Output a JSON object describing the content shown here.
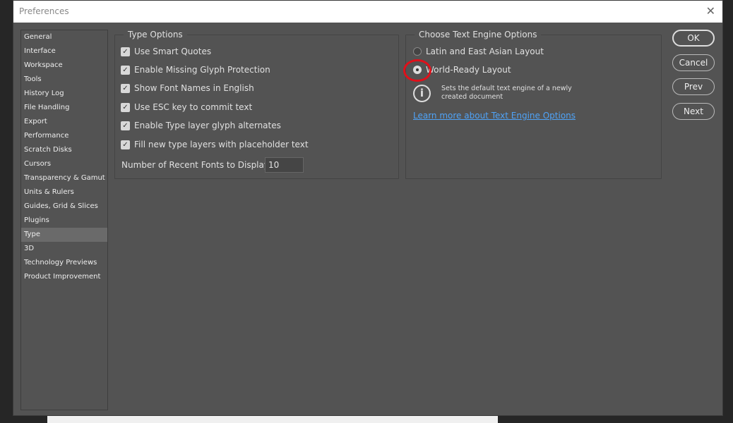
{
  "window": {
    "title": "Preferences",
    "close": "✕"
  },
  "sidebar": {
    "items": [
      {
        "label": "General"
      },
      {
        "label": "Interface"
      },
      {
        "label": "Workspace"
      },
      {
        "label": "Tools"
      },
      {
        "label": "History Log"
      },
      {
        "label": "File Handling"
      },
      {
        "label": "Export"
      },
      {
        "label": "Performance"
      },
      {
        "label": "Scratch Disks"
      },
      {
        "label": "Cursors"
      },
      {
        "label": "Transparency & Gamut"
      },
      {
        "label": "Units & Rulers"
      },
      {
        "label": "Guides, Grid & Slices"
      },
      {
        "label": "Plugins"
      },
      {
        "label": "Type"
      },
      {
        "label": "3D"
      },
      {
        "label": "Technology Previews"
      },
      {
        "label": "Product Improvement"
      }
    ],
    "selected": "Type"
  },
  "type_options": {
    "title": "Type Options",
    "checkboxes": [
      {
        "label": "Use Smart Quotes",
        "checked": true
      },
      {
        "label": "Enable Missing Glyph Protection",
        "checked": true
      },
      {
        "label": "Show Font Names in English",
        "checked": true
      },
      {
        "label": "Use ESC key to commit text",
        "checked": true
      },
      {
        "label": "Enable Type layer glyph alternates",
        "checked": true
      },
      {
        "label": "Fill new type layers with placeholder text",
        "checked": true
      }
    ],
    "recent_fonts_label": "Number of Recent Fonts to Display:",
    "recent_fonts_value": "10"
  },
  "engine": {
    "title": "Choose Text Engine Options",
    "options": [
      {
        "label": "Latin and East Asian Layout",
        "selected": false
      },
      {
        "label": "World-Ready Layout",
        "selected": true
      }
    ],
    "info": "Sets the default text engine of a newly created document",
    "link": "Learn more about Text Engine Options",
    "annotation_color": "#e0101a"
  },
  "buttons": {
    "ok": "OK",
    "cancel": "Cancel",
    "prev": "Prev",
    "next": "Next"
  }
}
